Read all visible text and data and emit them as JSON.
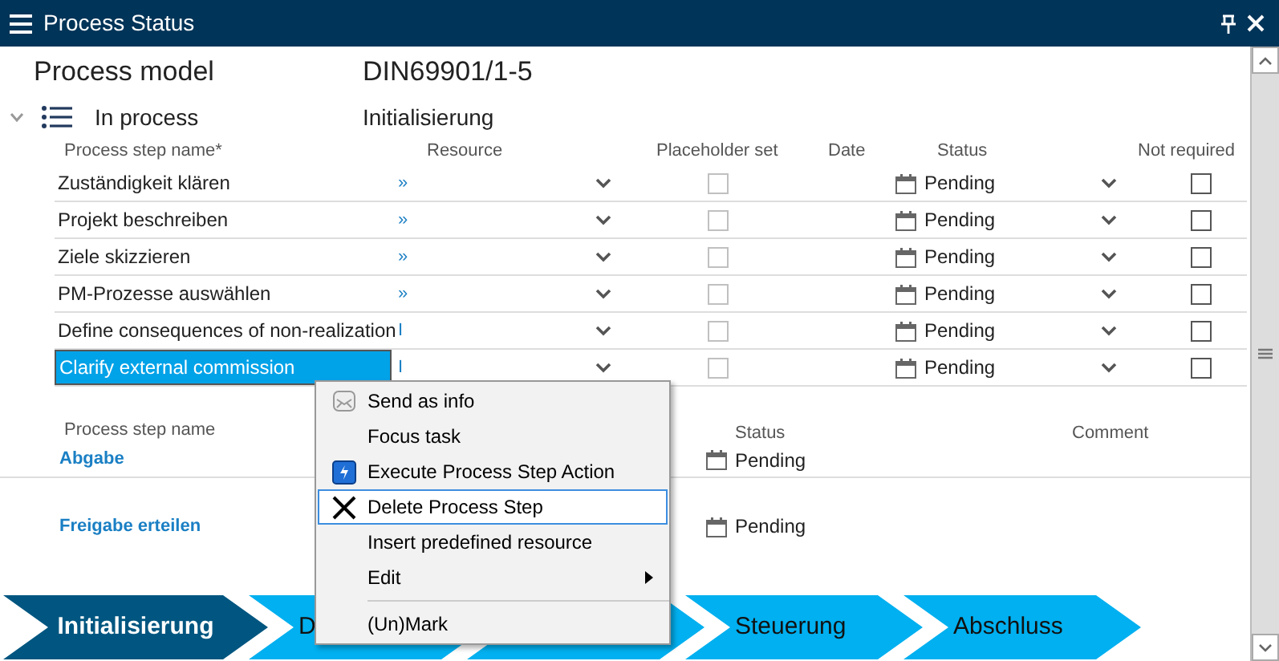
{
  "window": {
    "title": "Process Status"
  },
  "process_model": {
    "label": "Process model",
    "value": "DIN69901/1-5"
  },
  "phase": {
    "expanded": true,
    "label": "In process",
    "value": "Initialisierung"
  },
  "table": {
    "columns": [
      "Process step name*",
      "Resource",
      "Placeholder set",
      "Date",
      "Status",
      "Not required"
    ],
    "rows": [
      {
        "name": "Zuständigkeit klären",
        "resource": "»",
        "placeholder_set": false,
        "status": "Pending",
        "not_required": false,
        "selected": false
      },
      {
        "name": "Projekt beschreiben",
        "resource": "»",
        "placeholder_set": false,
        "status": "Pending",
        "not_required": false,
        "selected": false
      },
      {
        "name": "Ziele skizzieren",
        "resource": "»",
        "placeholder_set": false,
        "status": "Pending",
        "not_required": false,
        "selected": false
      },
      {
        "name": "PM-Prozesse auswählen",
        "resource": "»",
        "placeholder_set": false,
        "status": "Pending",
        "not_required": false,
        "selected": false
      },
      {
        "name": "Define consequences of non-realization",
        "resource": "I",
        "placeholder_set": false,
        "status": "Pending",
        "not_required": false,
        "selected": false
      },
      {
        "name": "Clarify external commission",
        "resource": "I",
        "placeholder_set": false,
        "status": "Pending",
        "not_required": false,
        "selected": true
      }
    ]
  },
  "milestones": {
    "columns": [
      "Process step name",
      "Status",
      "Comment"
    ],
    "rows": [
      {
        "name": "Abgabe",
        "status": "Pending"
      },
      {
        "name": "Freigabe erteilen",
        "status": "Pending"
      }
    ]
  },
  "context_menu": [
    {
      "kind": "info",
      "label": "Send as info",
      "selected": false
    },
    {
      "kind": "item",
      "label": "Focus task",
      "selected": false
    },
    {
      "kind": "action",
      "label": "Execute Process Step Action",
      "selected": false
    },
    {
      "kind": "delete",
      "label": "Delete Process Step",
      "selected": true
    },
    {
      "kind": "item",
      "label": "Insert predefined resource",
      "selected": false
    },
    {
      "kind": "submenu",
      "label": "Edit",
      "selected": false
    },
    {
      "kind": "separator"
    },
    {
      "kind": "item",
      "label": "(Un)Mark",
      "selected": false
    }
  ],
  "stages": [
    {
      "label": "Initialisierung",
      "selected": true
    },
    {
      "label": "D",
      "selected": false
    },
    {
      "selected": false
    },
    {
      "label": "Steuerung",
      "selected": false
    },
    {
      "label": "Abschluss",
      "selected": false
    }
  ]
}
